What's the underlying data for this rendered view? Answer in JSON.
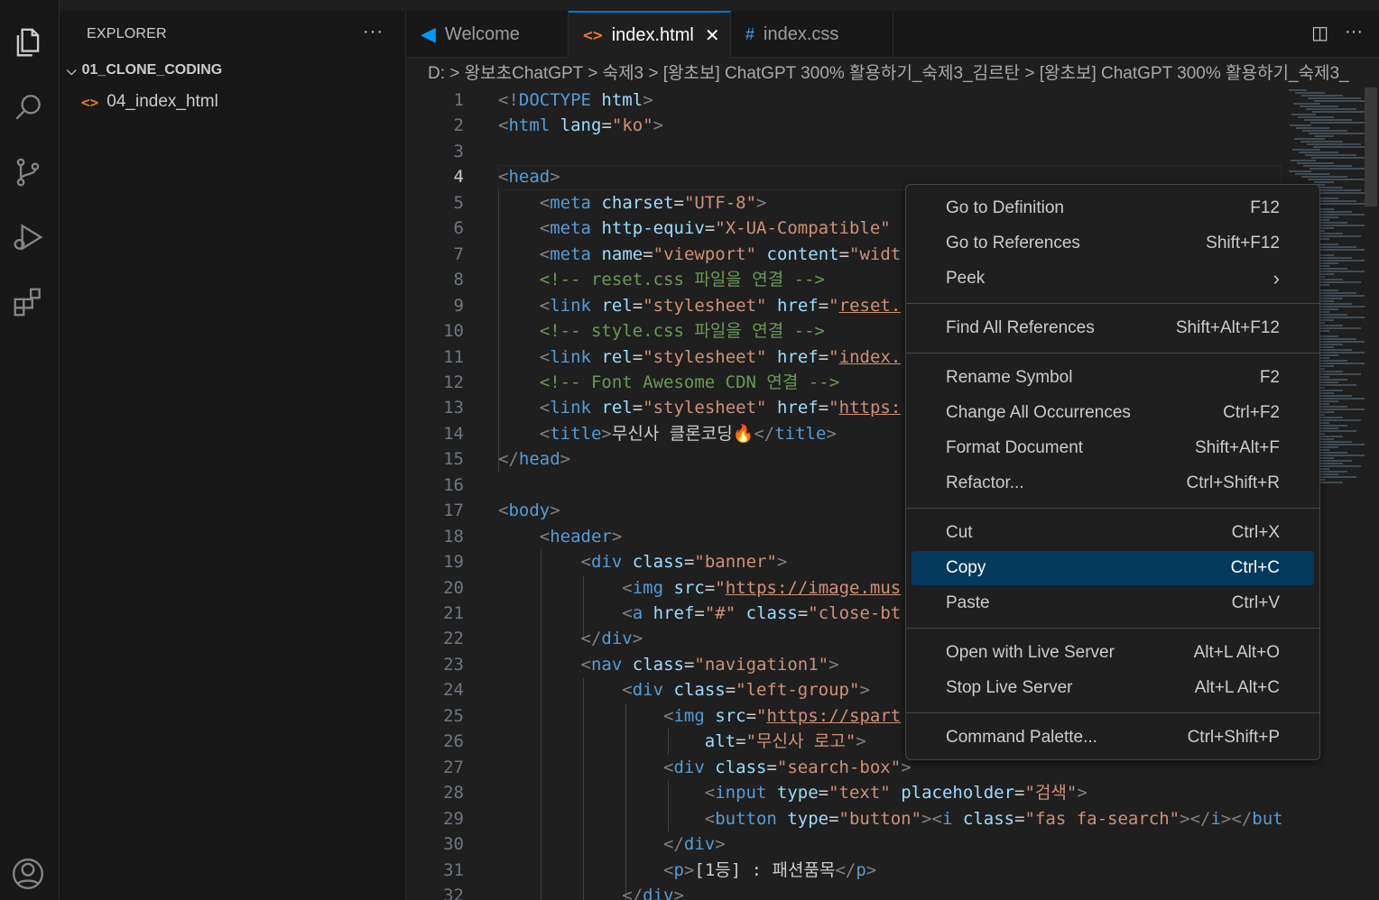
{
  "sidebar": {
    "title": "EXPLORER",
    "more": "···",
    "folder": "01_CLONE_CODING",
    "file": "04_index_html"
  },
  "tabs": [
    {
      "label": "Welcome"
    },
    {
      "label": "index.html"
    },
    {
      "label": "index.css"
    }
  ],
  "breadcrumb": "D: > 왕보초ChatGPT > 숙제3 > [왕초보] ChatGPT 300% 활용하기_숙제3_김르탄 > [왕초보] ChatGPT 300% 활용하기_숙제3_",
  "editor": {
    "lines": [
      "1",
      "2",
      "3",
      "4",
      "5",
      "6",
      "7",
      "8",
      "9",
      "10",
      "11",
      "12",
      "13",
      "14",
      "15",
      "16",
      "17",
      "18",
      "19",
      "20",
      "21",
      "22",
      "23",
      "24",
      "25",
      "26",
      "27",
      "28",
      "29",
      "30",
      "31",
      "32"
    ]
  },
  "context_menu": {
    "items": [
      {
        "label": "Go to Definition",
        "shortcut": "F12"
      },
      {
        "label": "Go to References",
        "shortcut": "Shift+F12"
      },
      {
        "label": "Peek",
        "shortcut": "›"
      },
      {
        "label": "Find All References",
        "shortcut": "Shift+Alt+F12"
      },
      {
        "label": "Rename Symbol",
        "shortcut": "F2"
      },
      {
        "label": "Change All Occurrences",
        "shortcut": "Ctrl+F2"
      },
      {
        "label": "Format Document",
        "shortcut": "Shift+Alt+F"
      },
      {
        "label": "Refactor...",
        "shortcut": "Ctrl+Shift+R"
      },
      {
        "label": "Cut",
        "shortcut": "Ctrl+X"
      },
      {
        "label": "Copy",
        "shortcut": "Ctrl+C"
      },
      {
        "label": "Paste",
        "shortcut": "Ctrl+V"
      },
      {
        "label": "Open with Live Server",
        "shortcut": "Alt+L Alt+O"
      },
      {
        "label": "Stop Live Server",
        "shortcut": "Alt+L Alt+C"
      },
      {
        "label": "Command Palette...",
        "shortcut": "Ctrl+Shift+P"
      }
    ]
  }
}
